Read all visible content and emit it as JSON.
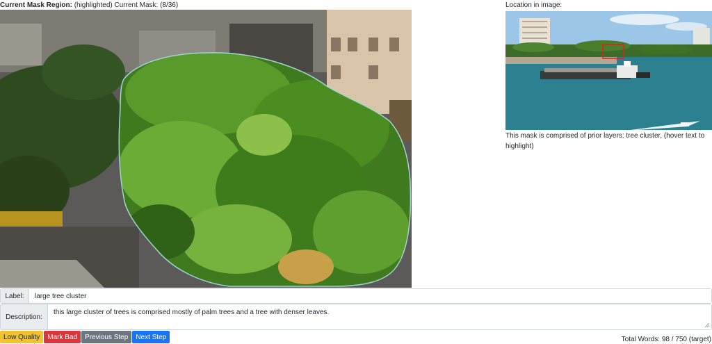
{
  "header": {
    "region_label": "Current Mask Region:",
    "status_text": "(highlighted) Current Mask: (8/36)"
  },
  "location": {
    "label": "Location in image:",
    "prior_layers_text": "This mask is comprised of prior layers: tree cluster, (hover text to highlight)"
  },
  "form": {
    "label_caption": "Label:",
    "label_value": "large tree cluster",
    "description_caption": "Description:",
    "description_value": "this large cluster of trees is comprised mostly of palm trees and a tree with denser leaves."
  },
  "buttons": {
    "low_quality": "Low Quality",
    "mark_bad": "Mark Bad",
    "previous_step": "Previous Step",
    "next_step": "Next Step"
  },
  "footer": {
    "word_count": "Total Words: 98 / 750 (target)"
  },
  "colors": {
    "low_quality": "#f1c232",
    "mark_bad": "#d9363e",
    "previous_step": "#6c757d",
    "next_step": "#1a73f0",
    "mask_outline": "#9fd6d0",
    "location_marker": "#e0201c"
  }
}
